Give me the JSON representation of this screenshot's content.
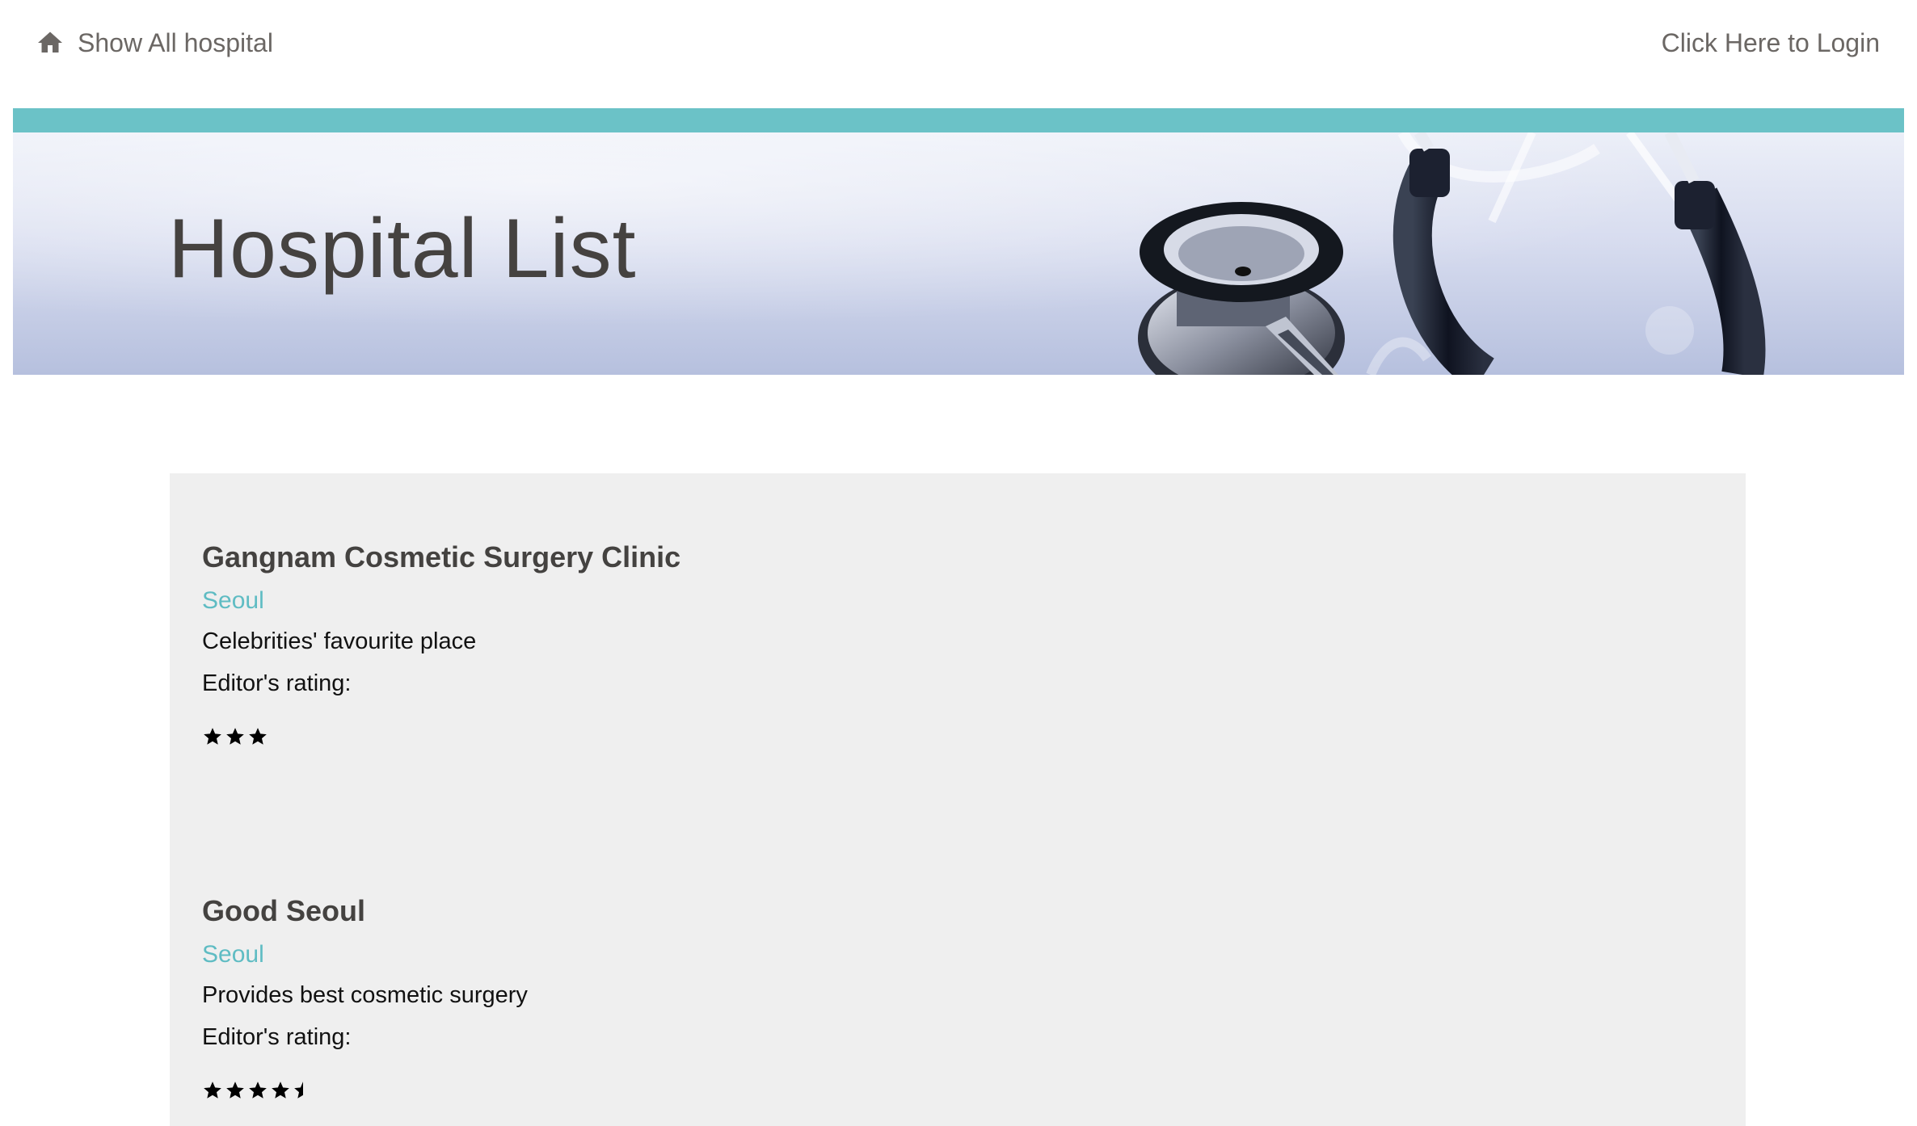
{
  "nav": {
    "home_label": "Show All hospital",
    "home_icon": "home-icon",
    "login_label": "Click Here to Login"
  },
  "hero": {
    "title": "Hospital List"
  },
  "colors": {
    "accent": "#6bc2c7",
    "city_link": "#5fbcc3",
    "panel_bg": "#efefef",
    "nav_text": "#6b6764"
  },
  "hospitals": [
    {
      "name": "Gangnam Cosmetic Surgery Clinic",
      "city": "Seoul",
      "description": "Celebrities' favourite place",
      "rating_label": "Editor's rating:",
      "rating": 3
    },
    {
      "name": "Good Seoul",
      "city": "Seoul",
      "description": "Provides best cosmetic surgery",
      "rating_label": "Editor's rating:",
      "rating": 4.5
    }
  ]
}
